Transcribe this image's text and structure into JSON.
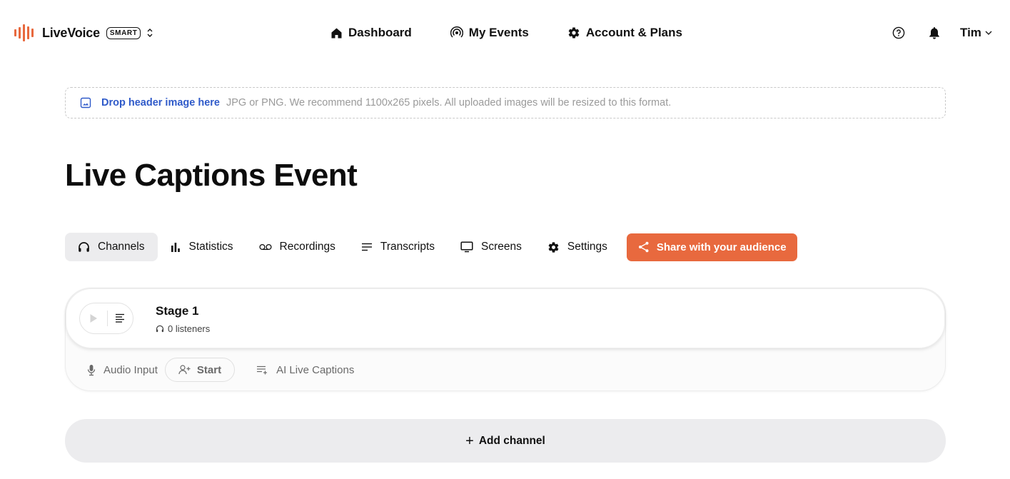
{
  "brand": {
    "name": "LiveVoice",
    "badge": "SMART",
    "accent_color": "#e8693e"
  },
  "nav": {
    "items": [
      {
        "label": "Dashboard",
        "icon": "home-icon"
      },
      {
        "label": "My Events",
        "icon": "broadcast-icon"
      },
      {
        "label": "Account & Plans",
        "icon": "gear-icon"
      }
    ],
    "user": "Tim"
  },
  "dropzone": {
    "title": "Drop header image here",
    "hint": "JPG or PNG. We recommend 1100x265 pixels. All uploaded images will be resized to this format."
  },
  "event": {
    "title": "Live Captions Event"
  },
  "tabs": [
    {
      "label": "Channels",
      "icon": "headphones-icon",
      "active": true
    },
    {
      "label": "Statistics",
      "icon": "bar-chart-icon",
      "active": false
    },
    {
      "label": "Recordings",
      "icon": "voicemail-icon",
      "active": false
    },
    {
      "label": "Transcripts",
      "icon": "lines-icon",
      "active": false
    },
    {
      "label": "Screens",
      "icon": "monitor-icon",
      "active": false
    },
    {
      "label": "Settings",
      "icon": "gear-icon",
      "active": false
    }
  ],
  "share": {
    "label": "Share with your audience",
    "color": "#e8693e"
  },
  "channel": {
    "name": "Stage 1",
    "listeners": "0 listeners",
    "audio_input_label": "Audio Input",
    "start_label": "Start",
    "captions_label": "AI Live Captions"
  },
  "add_channel": {
    "label": "Add channel"
  }
}
